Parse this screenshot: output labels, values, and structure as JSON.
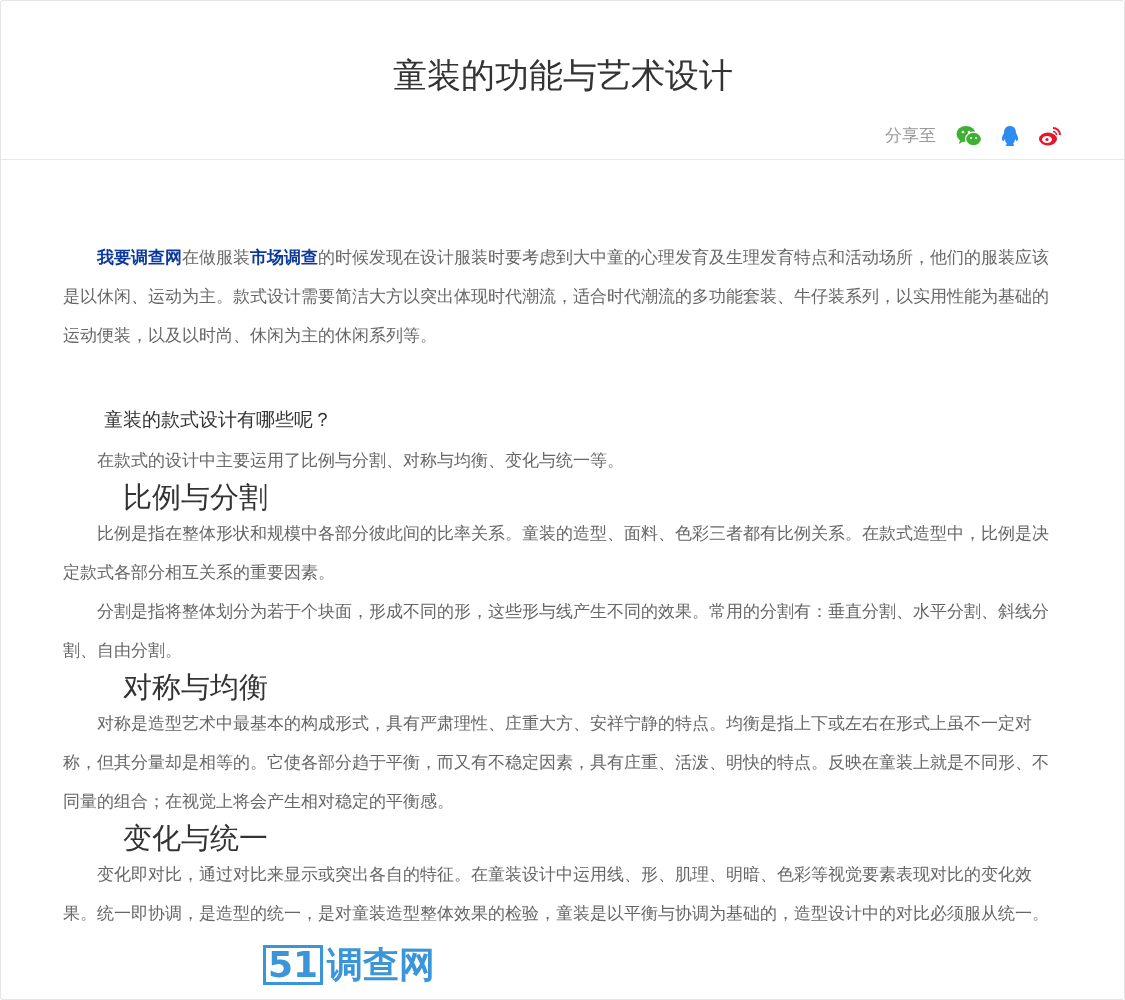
{
  "title": "童装的功能与艺术设计",
  "share": {
    "label": "分享至"
  },
  "blocks": [
    {
      "kind": "paragraph",
      "segments": [
        {
          "kind": "link",
          "text": "我要调查网"
        },
        {
          "kind": "text",
          "text": "在做服装"
        },
        {
          "kind": "link",
          "text": "市场调查"
        },
        {
          "kind": "text",
          "text": "的时候发现在设计服装时要考虑到大中童的心理发育及生理发育特点和活动场所，他们的服装应该是以休闲、运动为主。款式设计需要简洁大方以突出体现时代潮流，适合时代潮流的多功能套装、牛仔装系列，以实用性能为基础的运动便装，以及以时尚、休闲为主的休闲系列等。"
        }
      ]
    },
    {
      "kind": "subheading",
      "text": "童装的款式设计有哪些呢？"
    },
    {
      "kind": "paragraph",
      "segments": [
        {
          "kind": "text",
          "text": "在款式的设计中主要运用了比例与分割、对称与均衡、变化与统一等。"
        }
      ]
    },
    {
      "kind": "heading",
      "text": "比例与分割"
    },
    {
      "kind": "paragraph",
      "segments": [
        {
          "kind": "text",
          "text": "比例是指在整体形状和规模中各部分彼此间的比率关系。童装的造型、面料、色彩三者都有比例关系。在款式造型中，比例是决定款式各部分相互关系的重要因素。"
        }
      ]
    },
    {
      "kind": "paragraph",
      "segments": [
        {
          "kind": "text",
          "text": "分割是指将整体划分为若于个块面，形成不同的形，这些形与线产生不同的效果。常用的分割有：垂直分割、水平分割、斜线分割、自由分割。"
        }
      ]
    },
    {
      "kind": "heading",
      "text": "对称与均衡"
    },
    {
      "kind": "paragraph",
      "segments": [
        {
          "kind": "text",
          "text": "对称是造型艺术中最基本的构成形式，具有严肃理性、庄重大方、安祥宁静的特点。均衡是指上下或左右在形式上虽不一定对称，但其分量却是相等的。它使各部分趋于平衡，而又有不稳定因素，具有庄重、活泼、明快的特点。反映在童装上就是不同形、不同量的组合；在视觉上将会产生相对稳定的平衡感。"
        }
      ]
    },
    {
      "kind": "heading",
      "text": "变化与统一"
    },
    {
      "kind": "paragraph",
      "segments": [
        {
          "kind": "text",
          "text": "变化即对比，通过对比来显示或突出各自的特征。在童装设计中运用线、形、肌理、明暗、色彩等视觉要素表现对比的变化效果。统一即协调，是造型的统一，是对童装造型整体效果的检验，童装是以平衡与协调为基础的，造型设计中的对比必须服从统一。"
        }
      ]
    }
  ],
  "logo": {
    "number": "51",
    "name": "调查网"
  }
}
